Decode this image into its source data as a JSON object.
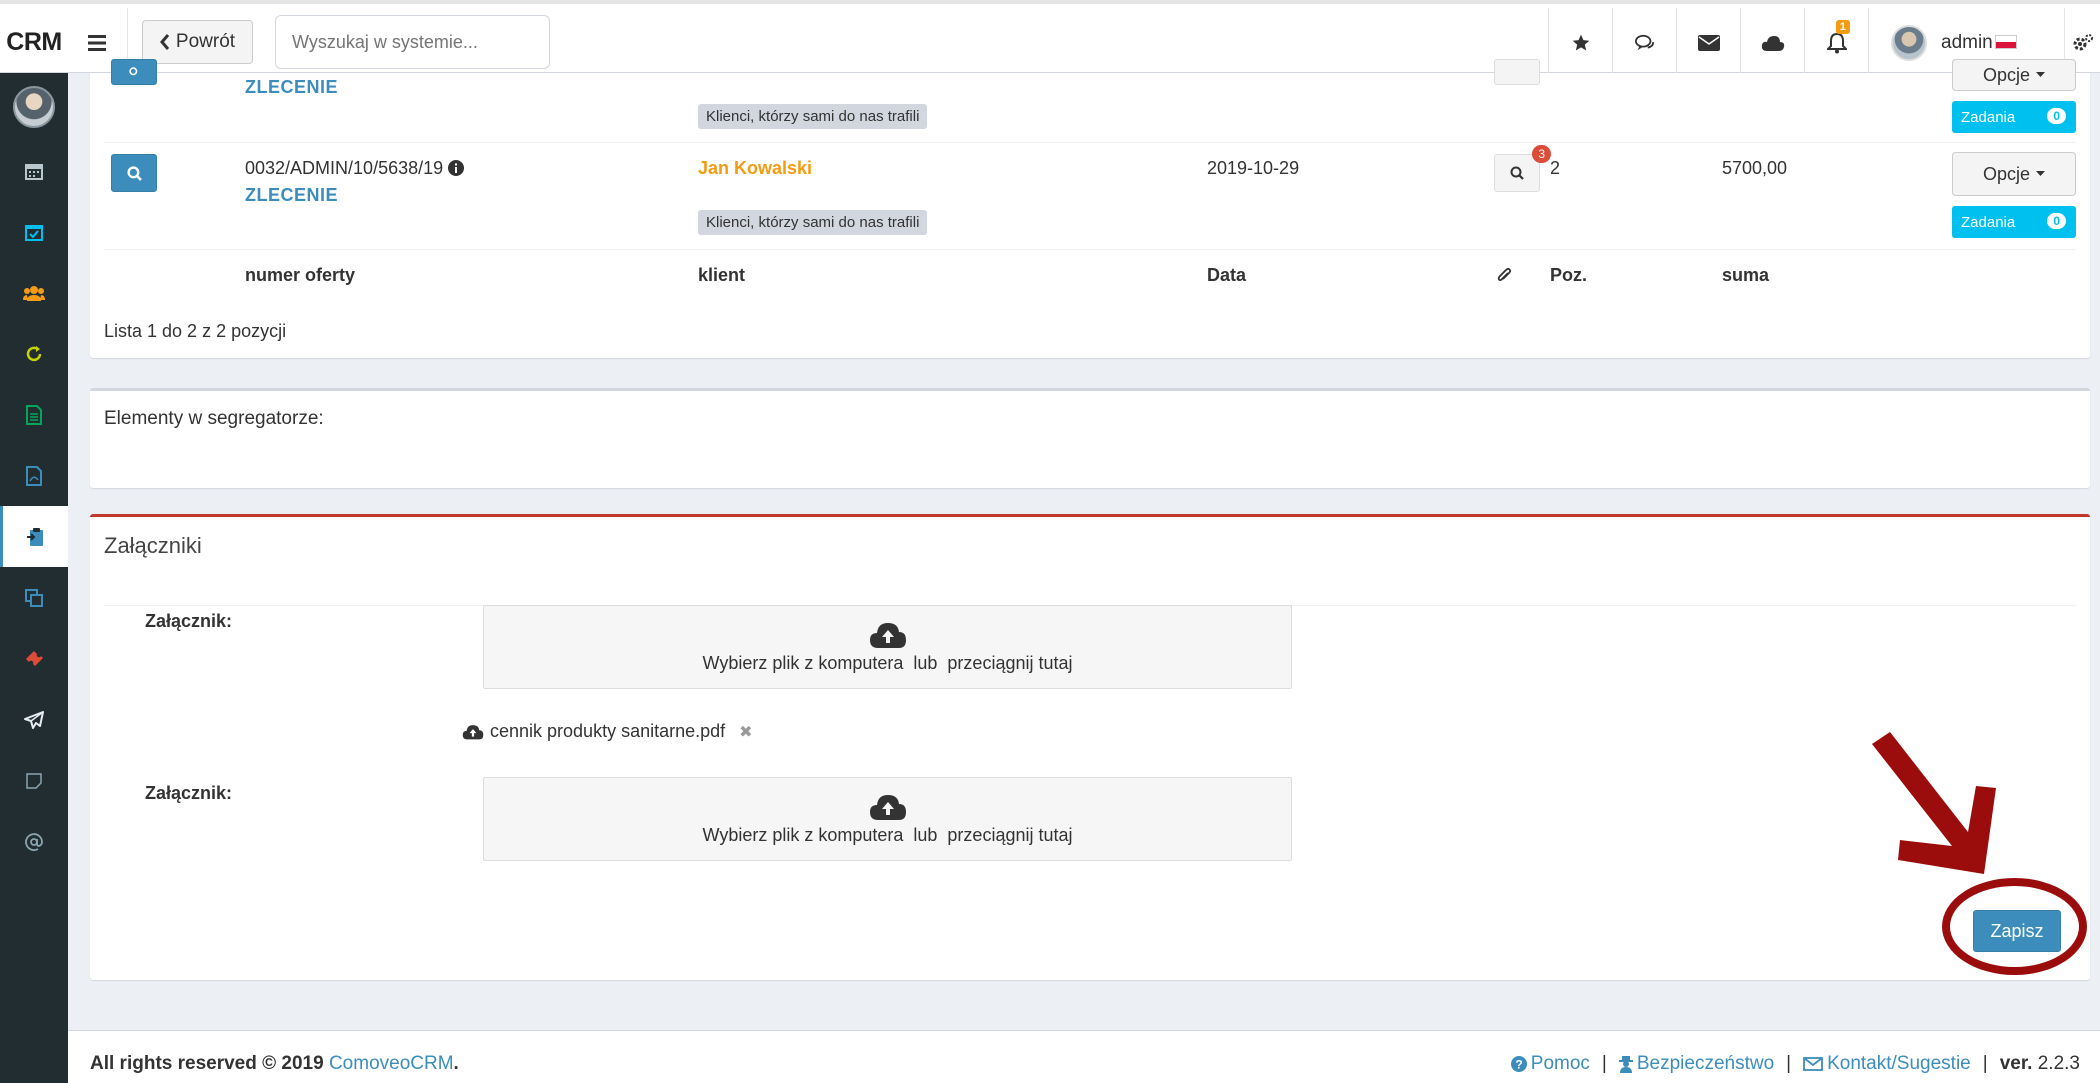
{
  "brand": "CRM",
  "toolbar": {
    "back_label": "Powrót",
    "search_placeholder": "Wyszukaj w systemie..."
  },
  "header": {
    "notifications_count": "1",
    "user_name": "admin"
  },
  "offers": {
    "rows": [
      {
        "number": "",
        "type": "ZLECENIE",
        "client": "",
        "tag": "Klienci, którzy sami do nas trafili",
        "date": "",
        "attachments": "",
        "positions": "",
        "sum": "",
        "options_label": "Opcje",
        "tasks_label": "Zadania",
        "tasks_count": "0"
      },
      {
        "number": "0032/ADMIN/10/5638/19",
        "type": "ZLECENIE",
        "client": "Jan Kowalski",
        "tag": "Klienci, którzy sami do nas trafili",
        "date": "2019-10-29",
        "attachments": "3",
        "positions": "2",
        "sum": "5700,00",
        "options_label": "Opcje",
        "tasks_label": "Zadania",
        "tasks_count": "0"
      }
    ],
    "columns": {
      "number": "numer oferty",
      "client": "klient",
      "date": "Data",
      "positions": "Poz.",
      "sum": "suma"
    },
    "list_info": "Lista 1 do 2 z 2 pozycji"
  },
  "binder": {
    "label": "Elementy w segregatorze:"
  },
  "attachments": {
    "title": "Załączniki",
    "field_label": "Załącznik:",
    "dropzone_text": "Wybierz plik z komputera  lub  przeciągnij tutaj",
    "uploaded_file": "cennik produkty sanitarne.pdf",
    "save_label": "Zapisz"
  },
  "footer": {
    "rights": "All rights reserved © 2019",
    "company": "ComoveoCRM",
    "help": "Pomoc",
    "security": "Bezpieczeństwo",
    "contact": "Kontakt/Sugestie",
    "version_label": "ver.",
    "version": "2.2.3"
  },
  "colors": {
    "primary": "#3c8dbc",
    "client": "#f39c12",
    "tasks": "#00c0ef",
    "danger_border": "#c0392b",
    "annotation": "#9b0d0d",
    "sidebar": "#222d32"
  }
}
